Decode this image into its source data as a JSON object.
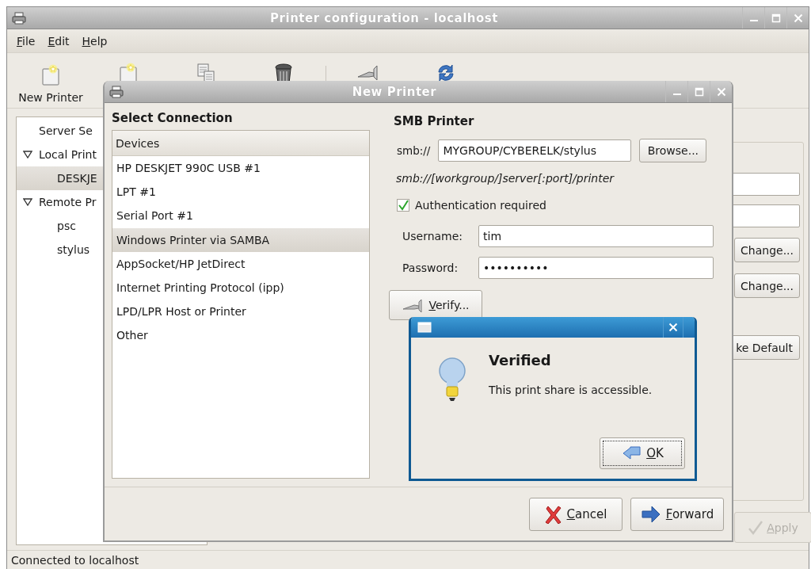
{
  "window": {
    "title": "Printer configuration - localhost"
  },
  "menu": [
    {
      "label": "File"
    },
    {
      "label": "Edit"
    },
    {
      "label": "Help"
    }
  ],
  "toolbar": {
    "label": "New Printer"
  },
  "sidebar": {
    "items": [
      {
        "label": "Server Se",
        "expanded": false,
        "selected": false
      },
      {
        "label": "Local Print",
        "expanded": true,
        "selected": false,
        "children": [
          {
            "label": "DESKJE",
            "selected": true
          }
        ]
      },
      {
        "label": "Remote Pr",
        "expanded": true,
        "selected": false,
        "children": [
          {
            "label": "psc",
            "selected": false
          },
          {
            "label": "stylus",
            "selected": false
          }
        ]
      }
    ]
  },
  "details": {
    "change_buttons": [
      "Change...",
      "Change..."
    ],
    "default_button": "ke Default",
    "apply": {
      "label": "Apply",
      "disabled": true
    }
  },
  "status_bar": "Connected to localhost",
  "new_printer": {
    "title": "New Printer",
    "connection_heading": "Select Connection",
    "list_header": "Devices",
    "connections": [
      {
        "label": "HP DESKJET 990C USB #1",
        "selected": false
      },
      {
        "label": "LPT #1",
        "selected": false
      },
      {
        "label": "Serial Port #1",
        "selected": false
      },
      {
        "label": "Windows Printer via SAMBA",
        "selected": true
      },
      {
        "label": "AppSocket/HP JetDirect",
        "selected": false
      },
      {
        "label": "Internet Printing Protocol (ipp)",
        "selected": false
      },
      {
        "label": "LPD/LPR Host or Printer",
        "selected": false
      },
      {
        "label": "Other",
        "selected": false
      }
    ],
    "smb": {
      "heading": "SMB Printer",
      "prefix": "smb://",
      "uri": "MYGROUP/CYBERELK/stylus",
      "browse": "Browse...",
      "hint": "smb://[workgroup/]server[:port]/printer",
      "auth": {
        "label": "Authentication required",
        "checked": true
      },
      "username_label": "Username:",
      "username": "tim",
      "password_label": "Password:",
      "password": "••••••••••",
      "verify": "Verify..."
    },
    "buttons": [
      {
        "kind": "cancel",
        "label": "Cancel"
      },
      {
        "kind": "forward",
        "label": "Forward"
      }
    ]
  },
  "message": {
    "heading": "Verified",
    "text": "This print share is accessible.",
    "button": "OK"
  }
}
